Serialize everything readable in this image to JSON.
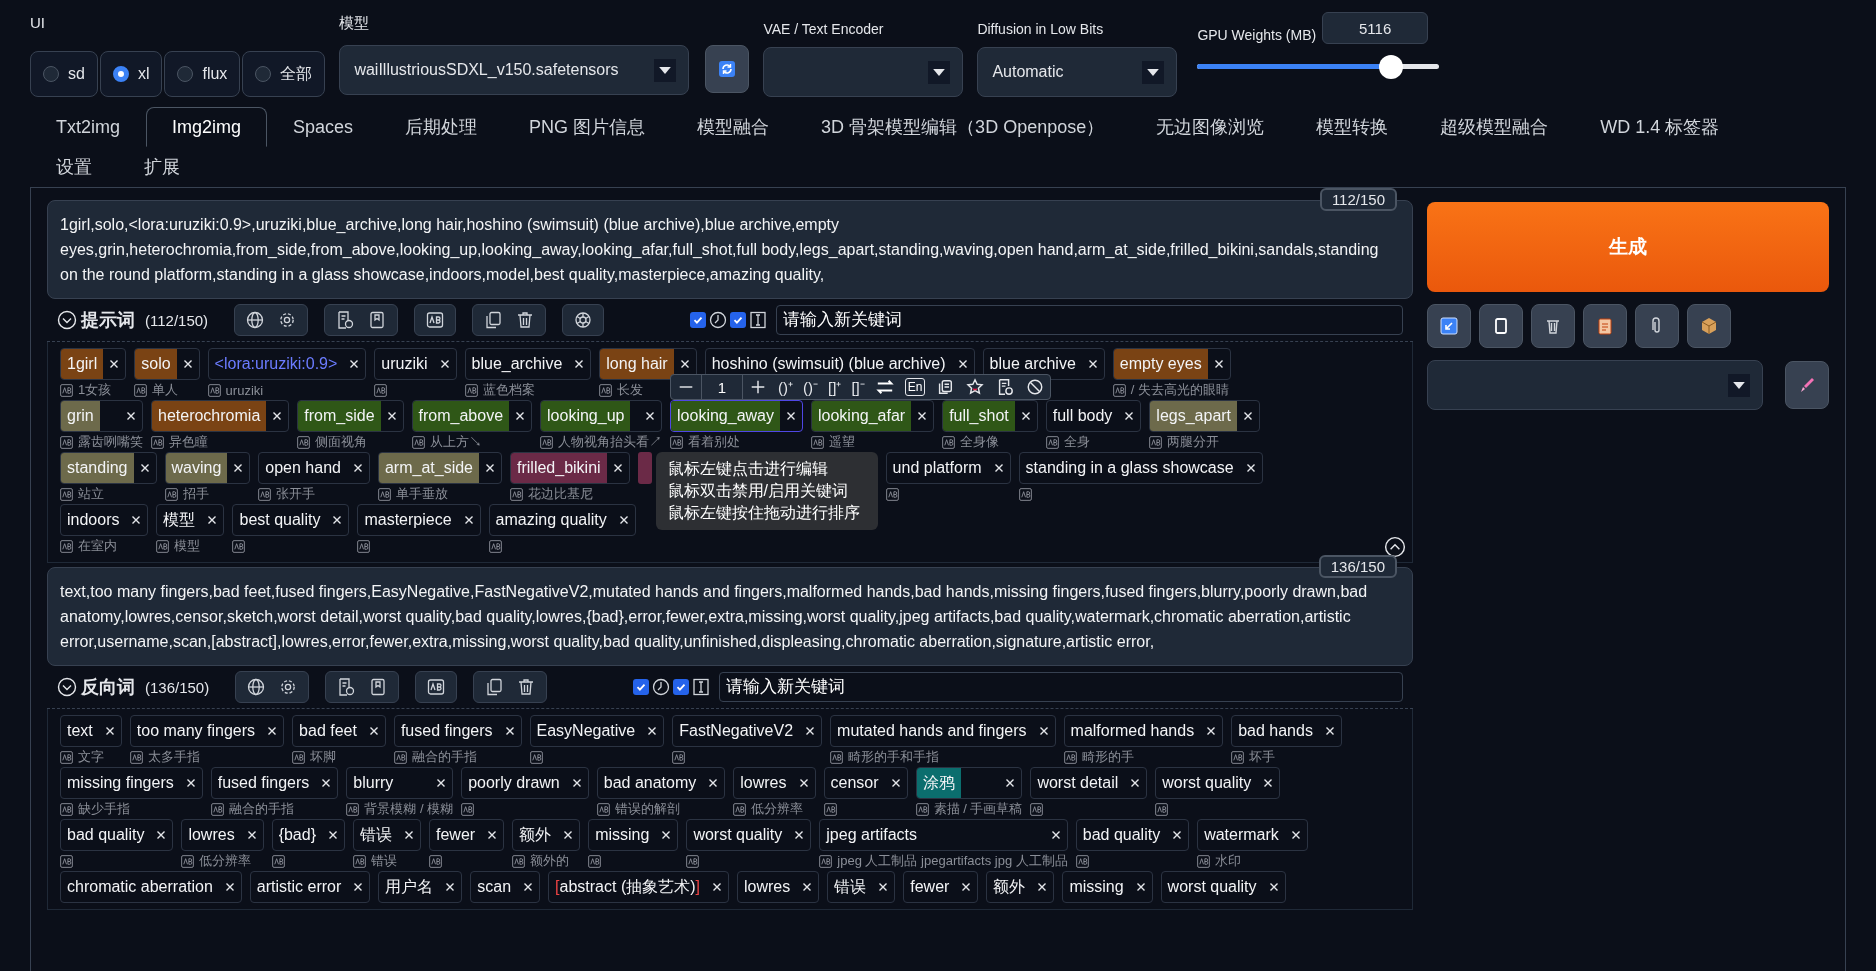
{
  "ui": {
    "label": "UI",
    "options": [
      {
        "label": "sd",
        "selected": false
      },
      {
        "label": "xl",
        "selected": true
      },
      {
        "label": "flux",
        "selected": false
      },
      {
        "label": "全部",
        "selected": false
      }
    ]
  },
  "model": {
    "label": "模型",
    "value": "waiIllustriousSDXL_v150.safetensors"
  },
  "vae": {
    "label": "VAE / Text Encoder"
  },
  "low_bits": {
    "label": "Diffusion in Low Bits",
    "value": "Automatic"
  },
  "gpu": {
    "label": "GPU Weights (MB)",
    "value": "5116",
    "level": 0.8
  },
  "tabs": [
    {
      "label": "Txt2img",
      "selected": false
    },
    {
      "label": "Img2img",
      "selected": true
    },
    {
      "label": "Spaces",
      "selected": false
    },
    {
      "label": "后期处理",
      "selected": false
    },
    {
      "label": "PNG 图片信息",
      "selected": false
    },
    {
      "label": "模型融合",
      "selected": false
    },
    {
      "label": "3D 骨架模型编辑（3D Openpose）",
      "selected": false
    },
    {
      "label": "无边图像浏览",
      "selected": false
    },
    {
      "label": "模型转换",
      "selected": false
    },
    {
      "label": "超级模型融合",
      "selected": false
    },
    {
      "label": "WD 1.4 标签器",
      "selected": false
    },
    {
      "label": "设置",
      "selected": false
    },
    {
      "label": "扩展",
      "selected": false
    }
  ],
  "prompts": [
    {
      "kind": "positive",
      "text": "1girl,solo,<lora:uruziki:0.9>,uruziki,blue_archive,long hair,hoshino (swimsuit) (blue archive),blue archive,empty eyes,grin,heterochromia,from_side,from_above,looking_up,looking_away,looking_afar,full_shot,full body,legs_apart,standing,waving,open hand,arm_at_side,frilled_bikini,sandals,standing on the round platform,standing in a glass showcase,indoors,model,best quality,masterpiece,amazing quality,",
      "counter": "112/150",
      "title": "提示词",
      "count": "(112/150)",
      "options": [
        {
          "checked": true
        },
        {
          "checked": true
        }
      ],
      "keyword_placeholder": "请输入新关键词",
      "tags": [
        {
          "kind": "tag",
          "text": "1girl",
          "translation": "1女孩",
          "color": "#7a4314"
        },
        {
          "kind": "tag",
          "text": "solo",
          "translation": "单人",
          "color": "#7a4314"
        },
        {
          "kind": "lora",
          "text": "<lora:uruziki:0.9>",
          "translation": "uruziki"
        },
        {
          "kind": "tag",
          "text": "uruziki"
        },
        {
          "kind": "tag",
          "text": "blue_archive",
          "translation": "蓝色档案"
        },
        {
          "kind": "tag",
          "text": "long hair",
          "translation": "长发",
          "color": "#7a4314"
        },
        {
          "kind": "tag",
          "text": "hoshino (swimsuit) (blue archive)"
        },
        {
          "kind": "tag",
          "text": "blue archive"
        },
        {
          "kind": "tag",
          "text": "empty eyes",
          "translation": "/ 失去高光的眼睛",
          "color": "#7a4314"
        },
        {
          "kind": "tag",
          "text": "grin",
          "translation": "露齿咧嘴笑",
          "color": "#6d6a4b"
        },
        {
          "kind": "tag",
          "text": "heterochromia",
          "translation": "异色瞳",
          "color": "#7a4314"
        },
        {
          "kind": "tag",
          "text": "from_side",
          "translation": "侧面视角",
          "color": "#2f5717"
        },
        {
          "kind": "tag",
          "text": "from_above",
          "translation": "从上方↘",
          "color": "#2f5717"
        },
        {
          "kind": "tag",
          "text": "looking_up",
          "translation": "人物视角抬头看↗",
          "color": "#2f5717"
        },
        {
          "kind": "tag",
          "text": "looking_away",
          "translation": "看着别处",
          "color": "#2f5717",
          "hovered": true
        },
        {
          "kind": "tag",
          "text": "looking_afar",
          "translation": "遥望",
          "color": "#2f5717"
        },
        {
          "kind": "tag",
          "text": "full_shot",
          "translation": "全身像",
          "color": "#2f5717"
        },
        {
          "kind": "tag",
          "text": "full body",
          "translation": "全身"
        },
        {
          "kind": "tag",
          "text": "legs_apart",
          "translation": "两腿分开",
          "color": "#6d6a4b"
        },
        {
          "kind": "tag",
          "text": "standing",
          "translation": "站立",
          "color": "#6d6a4b"
        },
        {
          "kind": "tag",
          "text": "waving",
          "translation": "招手",
          "color": "#6d6a4b"
        },
        {
          "kind": "tag",
          "text": "open hand",
          "translation": "张开手"
        },
        {
          "kind": "tag",
          "text": "arm_at_side",
          "translation": "单手垂放",
          "color": "#6d6a4b"
        },
        {
          "kind": "tag",
          "text": "frilled_bikini",
          "translation": "花边比基尼",
          "color": "#6b2a47"
        },
        {
          "kind": "covered",
          "color": "#6b2a47"
        },
        {
          "kind": "tag",
          "text": "und platform"
        },
        {
          "kind": "tag",
          "text": "standing in a glass showcase"
        },
        {
          "kind": "tag",
          "text": "indoors",
          "translation": "在室内"
        },
        {
          "kind": "tag",
          "text": "模型",
          "translation": "模型"
        },
        {
          "kind": "tag",
          "text": "best quality"
        },
        {
          "kind": "tag",
          "text": "masterpiece"
        },
        {
          "kind": "tag",
          "text": "amazing quality"
        }
      ]
    },
    {
      "kind": "negative",
      "text": "text,too many fingers,bad feet,fused fingers,EasyNegative,FastNegativeV2,mutated hands and fingers,malformed hands,bad hands,missing fingers,fused fingers,blurry,poorly drawn,bad anatomy,lowres,censor,sketch,worst detail,worst quality,bad quality,lowres,{bad},error,fewer,extra,missing,worst quality,jpeg artifacts,bad quality,watermark,chromatic aberration,artistic error,username,scan,[abstract],lowres,error,fewer,extra,missing,worst quality,bad quality,unfinished,displeasing,chromatic aberration,signature,artistic error,",
      "counter": "136/150",
      "title": "反向词",
      "count": "(136/150)",
      "options": [
        {
          "checked": true
        },
        {
          "checked": true
        }
      ],
      "keyword_placeholder": "请输入新关键词",
      "tags": [
        {
          "kind": "tag",
          "text": "text",
          "translation": "文字"
        },
        {
          "kind": "tag",
          "text": "too many fingers",
          "translation": "太多手指"
        },
        {
          "kind": "tag",
          "text": "bad feet",
          "translation": "坏脚"
        },
        {
          "kind": "tag",
          "text": "fused fingers",
          "translation": "融合的手指"
        },
        {
          "kind": "tag",
          "text": "EasyNegative"
        },
        {
          "kind": "tag",
          "text": "FastNegativeV2"
        },
        {
          "kind": "tag",
          "text": "mutated hands and fingers",
          "translation": "畸形的手和手指"
        },
        {
          "kind": "tag",
          "text": "malformed hands",
          "translation": "畸形的手"
        },
        {
          "kind": "tag",
          "text": "bad hands",
          "translation": "坏手"
        },
        {
          "kind": "tag",
          "text": "missing fingers",
          "translation": "缺少手指"
        },
        {
          "kind": "tag",
          "text": "fused fingers",
          "translation": "融合的手指"
        },
        {
          "kind": "tag",
          "text": "blurry",
          "translation": "背景模糊 / 模糊"
        },
        {
          "kind": "tag",
          "text": "poorly drawn"
        },
        {
          "kind": "tag",
          "text": "bad anatomy",
          "translation": "错误的解剖"
        },
        {
          "kind": "tag",
          "text": "lowres",
          "translation": "低分辨率"
        },
        {
          "kind": "tag",
          "text": "censor"
        },
        {
          "kind": "tag",
          "text": "涂鸦",
          "translation": "素描 / 手画草稿",
          "color": "#0b6e6e"
        },
        {
          "kind": "tag",
          "text": "worst detail"
        },
        {
          "kind": "tag",
          "text": "worst quality"
        },
        {
          "kind": "tag",
          "text": "bad quality"
        },
        {
          "kind": "tag",
          "text": "lowres",
          "translation": "低分辨率"
        },
        {
          "kind": "tag",
          "text": "{bad}"
        },
        {
          "kind": "tag",
          "text": "错误",
          "translation": "错误"
        },
        {
          "kind": "tag",
          "text": "fewer"
        },
        {
          "kind": "tag",
          "text": "额外",
          "translation": "额外的"
        },
        {
          "kind": "tag",
          "text": "missing"
        },
        {
          "kind": "tag",
          "text": "worst quality"
        },
        {
          "kind": "tag",
          "text": "jpeg artifacts",
          "translation": "jpeg 人工制品 jpegartifacts jpg 人工制品"
        },
        {
          "kind": "tag",
          "text": "bad quality"
        },
        {
          "kind": "tag",
          "text": "watermark",
          "translation": "水印"
        },
        {
          "kind": "tag",
          "text": "chromatic aberration"
        },
        {
          "kind": "tag",
          "text": "artistic error"
        },
        {
          "kind": "tag",
          "text": "用户名"
        },
        {
          "kind": "tag",
          "text": "scan"
        },
        {
          "kind": "bracket",
          "text": "[abstract (抽象艺术)]"
        },
        {
          "kind": "tag",
          "text": "lowres"
        },
        {
          "kind": "tag",
          "text": "错误"
        },
        {
          "kind": "tag",
          "text": "fewer"
        },
        {
          "kind": "tag",
          "text": "额外"
        },
        {
          "kind": "tag",
          "text": "missing"
        },
        {
          "kind": "tag",
          "text": "worst quality"
        }
      ]
    }
  ],
  "tag_toolbar": {
    "weight": "1",
    "buttons": [
      "()⁺",
      "()⁻",
      "[]⁺",
      "[]⁻"
    ],
    "badge": "En"
  },
  "tooltip": [
    "鼠标左键点击进行编辑",
    "鼠标双击禁用/启用关键词",
    "鼠标左键按住拖动进行排序"
  ],
  "generate": "生成"
}
